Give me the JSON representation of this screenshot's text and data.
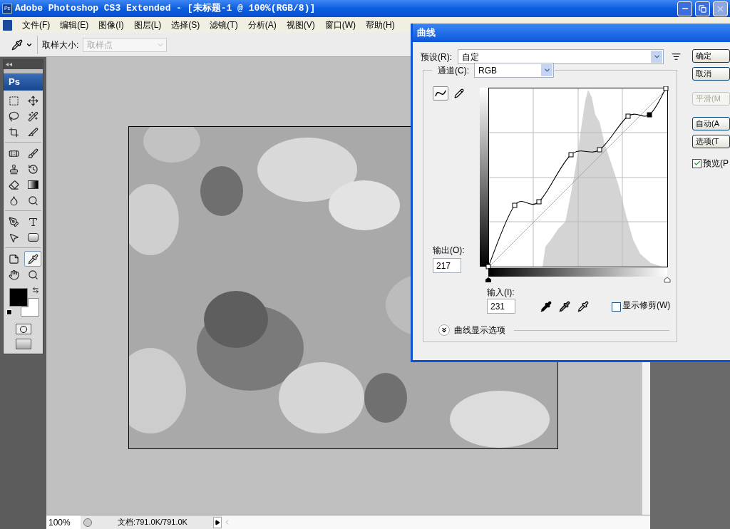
{
  "window": {
    "icon_text": "Ps",
    "title": "Adobe Photoshop CS3 Extended - [未标题-1 @ 100%(RGB/8)]"
  },
  "menu": [
    "文件(F)",
    "编辑(E)",
    "图像(I)",
    "图层(L)",
    "选择(S)",
    "滤镜(T)",
    "分析(A)",
    "视图(V)",
    "窗口(W)",
    "帮助(H)"
  ],
  "options_bar": {
    "sample_size_label": "取样大小:",
    "sample_size_value": "取样点"
  },
  "toolbox": {
    "logo": "Ps",
    "tools": [
      {
        "kind": "marquee",
        "selected": false
      },
      {
        "kind": "move",
        "selected": false
      },
      {
        "kind": "lasso",
        "selected": false
      },
      {
        "kind": "wand",
        "selected": false
      },
      {
        "kind": "crop",
        "selected": false
      },
      {
        "kind": "slice",
        "selected": false
      },
      {
        "kind": "heal",
        "selected": false
      },
      {
        "kind": "brush",
        "selected": false
      },
      {
        "kind": "stamp",
        "selected": false
      },
      {
        "kind": "history",
        "selected": false
      },
      {
        "kind": "eraser",
        "selected": false
      },
      {
        "kind": "gradient",
        "selected": false
      },
      {
        "kind": "blur",
        "selected": false
      },
      {
        "kind": "dodge",
        "selected": false
      },
      {
        "kind": "pen",
        "selected": false
      },
      {
        "kind": "type",
        "selected": false
      },
      {
        "kind": "path",
        "selected": false
      },
      {
        "kind": "shape",
        "selected": false
      },
      {
        "kind": "notes",
        "selected": false
      },
      {
        "kind": "eyedropper",
        "selected": true
      },
      {
        "kind": "hand",
        "selected": false
      },
      {
        "kind": "zoom",
        "selected": false
      }
    ]
  },
  "dialog": {
    "title": "曲线",
    "preset_label": "预设(R):",
    "preset_value": "自定",
    "channel_label": "通道(C):",
    "channel_value": "RGB",
    "curve_tools": [
      {
        "kind": "curve",
        "selected": true
      },
      {
        "kind": "pencil",
        "selected": false
      }
    ],
    "output_label": "输出(O):",
    "output_value": "217",
    "input_label": "输入(I):",
    "input_value": "231",
    "show_clipping": {
      "label": "显示修剪(W)",
      "checked": false
    },
    "display_options": "曲线显示选项",
    "buttons": [
      {
        "label": "确定",
        "disabled": false
      },
      {
        "label": "取消",
        "disabled": false
      },
      {
        "label": "平滑(M",
        "disabled": true
      },
      {
        "label": "自动(A",
        "disabled": false
      },
      {
        "label": "选项(T",
        "disabled": false
      }
    ],
    "preview": {
      "label": "预览(P",
      "checked": true
    }
  },
  "status_bar": {
    "zoom": "100%",
    "document": "文档:791.0K/791.0K"
  }
}
